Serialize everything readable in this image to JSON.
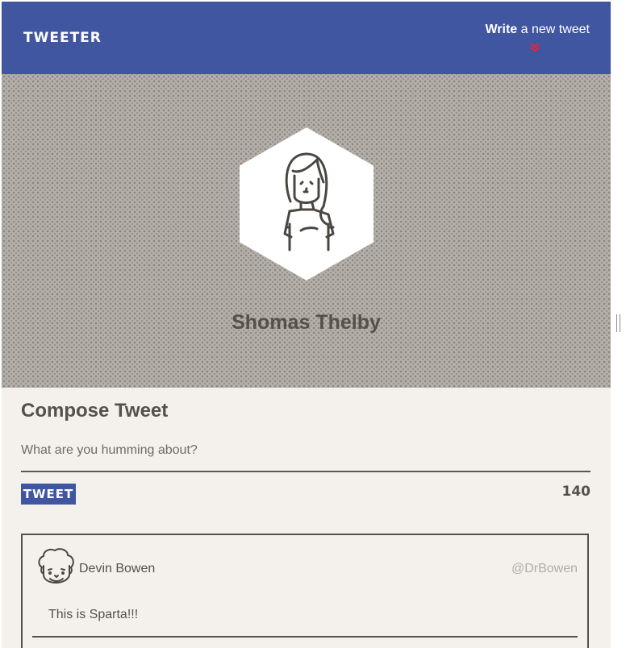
{
  "nav": {
    "brand": "TWEETER",
    "write_bold": "Write",
    "write_rest": " a new tweet"
  },
  "profile": {
    "name": "Shomas Thelby"
  },
  "compose": {
    "title": "Compose Tweet",
    "placeholder": "What are you humming about?",
    "button_label": "TWEET",
    "counter": "140"
  },
  "tweets": [
    {
      "name": "Devin Bowen",
      "handle": "@DrBowen",
      "text": "This is Sparta!!!"
    }
  ],
  "colors": {
    "nav_bg": "#4056a1",
    "page_bg": "#f4f1ec",
    "text": "#545149",
    "accent": "#e0263c"
  },
  "icons": {
    "nav_chevron": "double-chevron-down-icon",
    "profile_avatar": "woman-avatar-icon",
    "tweet_avatar": "man-avatar-icon"
  }
}
